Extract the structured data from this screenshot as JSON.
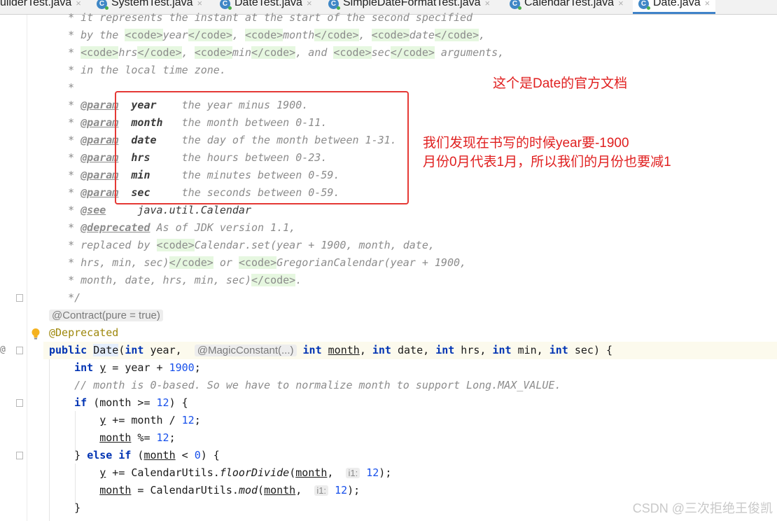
{
  "tabs": [
    {
      "name": "uilderTest.java",
      "active": false,
      "has_icon": false
    },
    {
      "name": "SystemTest.java",
      "active": false,
      "has_icon": true
    },
    {
      "name": "DateTest.java",
      "active": false,
      "has_icon": true
    },
    {
      "name": "SimpleDateFormatTest.java",
      "active": false,
      "has_icon": true
    },
    {
      "name": "CalendarTest.java",
      "active": false,
      "has_icon": true
    },
    {
      "name": "Date.java",
      "active": true,
      "has_icon": true
    }
  ],
  "tab_icon_letter": "C",
  "tab_close_glyph": "×",
  "colors": {
    "keyword": "#0033b3",
    "number": "#1750eb",
    "annotation": "#9e880d",
    "comment": "#8c8c8c",
    "annotation_red": "#e53935",
    "active_tab_underline": "#4083c9"
  },
  "icons": {
    "gutter_bulb": "lightbulb-icon",
    "fold_markers": "fold-marker-icon",
    "class_icon": "class-c-icon"
  },
  "code_lines": [
    "it represents the instant at the start of the second specified",
    "by the <code>year</code>, <code>month</code>, <code>date</code>,",
    "<code>hrs</code>, <code>min</code>, and <code>sec</code> arguments,",
    "in the local time zone."
  ],
  "params": [
    {
      "tag": "@param",
      "name": "year",
      "desc": "the year minus 1900."
    },
    {
      "tag": "@param",
      "name": "month",
      "desc": "the month between 0-11."
    },
    {
      "tag": "@param",
      "name": "date",
      "desc": "the day of the month between 1-31."
    },
    {
      "tag": "@param",
      "name": "hrs",
      "desc": "the hours between 0-23."
    },
    {
      "tag": "@param",
      "name": "min",
      "desc": "the minutes between 0-59."
    },
    {
      "tag": "@param",
      "name": "sec",
      "desc": "the seconds between 0-59."
    }
  ],
  "see": {
    "tag": "@see",
    "ref": "java.util.Calendar"
  },
  "deprecated": {
    "tag": "@deprecated",
    "text": "As of JDK version 1.1,"
  },
  "replaced_lines": [
    "replaced by <code>Calendar.set(year + 1900, month, date,",
    "hrs, min, sec)</code> or <code>GregorianCalendar(year + 1900,",
    "month, date, hrs, min, sec)</code>."
  ],
  "contract_inlay": "@Contract(pure = true)",
  "deprecated_annotation": "@Deprecated",
  "magic_inlay": "@MagicConstant(...)",
  "hint_i1": "i1:",
  "comment_line": "// month is 0-based. So we have to normalize month to support Long.MAX_VALUE.",
  "notes": {
    "official_doc": "这个是Date的官方文档",
    "finding_line1": "我们发现在书写的时候year要-1900",
    "finding_line2": "月份0月代表1月，所以我们的月份也要减1"
  },
  "watermark": "CSDN @三次拒绝王俊凯"
}
